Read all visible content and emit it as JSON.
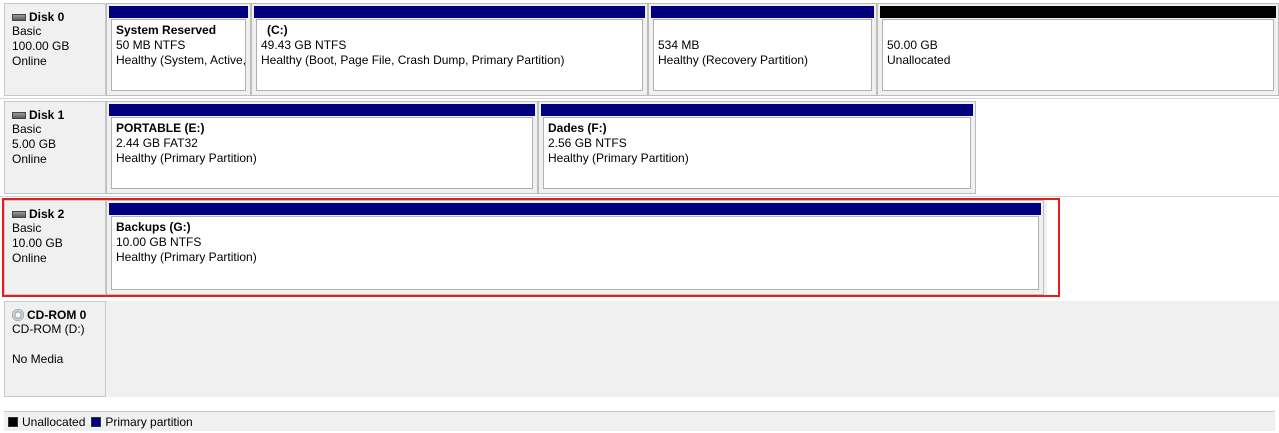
{
  "colors": {
    "primary": "#00007f",
    "unallocated": "#000000",
    "highlight": "#e0201e"
  },
  "disks": [
    {
      "name": "Disk 0",
      "type": "Basic",
      "size": "100.00 GB",
      "status": "Online",
      "icon": "hard-disk-icon",
      "volumes": [
        {
          "title": "System Reserved",
          "size": "50 MB NTFS",
          "status": "Healthy (System, Active,",
          "kind": "primary"
        },
        {
          "title": "(C:)",
          "size": "49.43 GB NTFS",
          "status": "Healthy (Boot, Page File, Crash Dump, Primary Partition)",
          "kind": "primary"
        },
        {
          "title": "",
          "size": "534 MB",
          "status": "Healthy (Recovery Partition)",
          "kind": "primary"
        },
        {
          "title": "",
          "size": "50.00 GB",
          "status": "Unallocated",
          "kind": "unallocated"
        }
      ]
    },
    {
      "name": "Disk 1",
      "type": "Basic",
      "size": "5.00 GB",
      "status": "Online",
      "icon": "hard-disk-icon",
      "volumes": [
        {
          "title": "PORTABLE  (E:)",
          "size": "2.44 GB FAT32",
          "status": "Healthy (Primary Partition)",
          "kind": "primary"
        },
        {
          "title": "Dades  (F:)",
          "size": "2.56 GB NTFS",
          "status": "Healthy (Primary Partition)",
          "kind": "primary"
        }
      ]
    },
    {
      "name": "Disk 2",
      "type": "Basic",
      "size": "10.00 GB",
      "status": "Online",
      "icon": "hard-disk-icon",
      "volumes": [
        {
          "title": "Backups  (G:)",
          "size": "10.00 GB NTFS",
          "status": "Healthy (Primary Partition)",
          "kind": "primary"
        }
      ]
    }
  ],
  "cdrom": {
    "name": "CD-ROM 0",
    "drive": "CD-ROM (D:)",
    "status": "No Media",
    "icon": "cd-drive-icon"
  },
  "legend": [
    {
      "label": "Unallocated",
      "kind": "unallocated"
    },
    {
      "label": "Primary partition",
      "kind": "primary"
    }
  ]
}
